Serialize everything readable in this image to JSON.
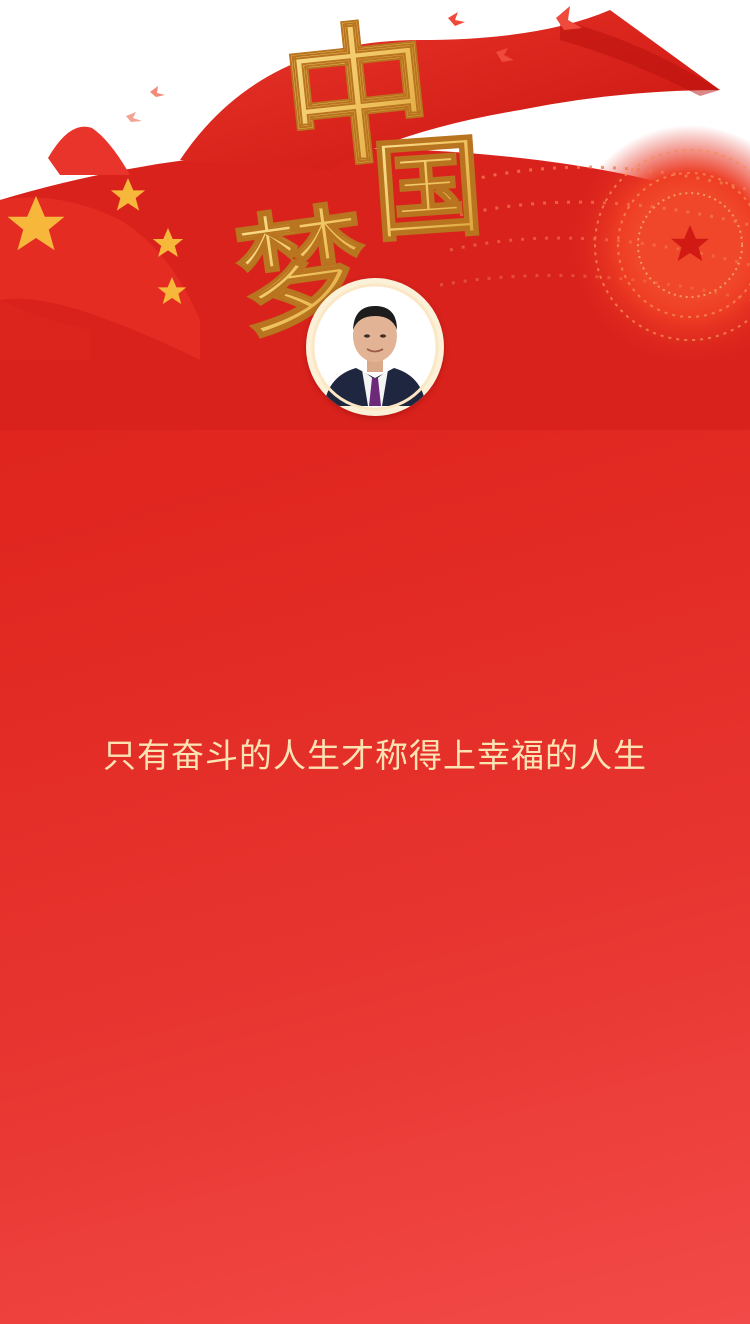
{
  "title_characters": [
    "中",
    "国",
    "梦"
  ],
  "slogan": "只有奋斗的人生才称得上幸福的人生",
  "colors": {
    "background_top": "#d9221c",
    "background_bottom": "#f24a48",
    "gold": "#f5cf72",
    "slogan_text": "#fbe3b4"
  },
  "icons": [
    "flag-star-icon",
    "dove-icon",
    "tiananmen-star-icon"
  ]
}
